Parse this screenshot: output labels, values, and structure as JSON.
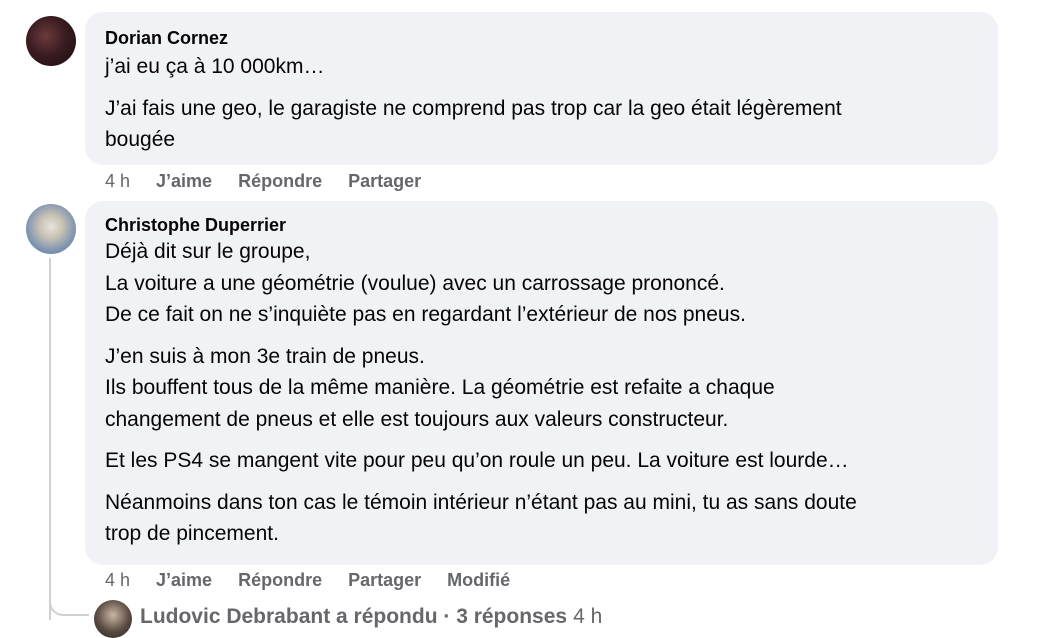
{
  "comments": [
    {
      "author": "Dorian Cornez",
      "paragraphs": [
        [
          "j’ai eu ça à 10 000km…"
        ],
        [
          "J’ai fais une geo, le garagiste ne comprend pas trop car la geo était légèrement",
          "bougée"
        ]
      ],
      "time": "4 h",
      "like": "J’aime",
      "reply": "Répondre",
      "share": "Partager"
    },
    {
      "author": "Christophe Duperrier",
      "paragraphs": [
        [
          "Déjà dit sur le groupe,",
          "La voiture a une géométrie (voulue) avec un carrossage prononcé.",
          "De ce fait on ne s’inquiète pas en regardant l’extérieur de nos pneus."
        ],
        [
          "J’en suis à mon 3e train de pneus.",
          "Ils bouffent tous de la même manière. La géométrie est refaite a chaque",
          "changement de pneus et elle est toujours aux valeurs constructeur."
        ],
        [
          "Et les PS4 se mangent vite pour peu qu’on roule un peu. La voiture est lourde…"
        ],
        [
          "Néanmoins dans ton cas le témoin intérieur n’étant pas au mini, tu as sans doute",
          "trop de pincement."
        ]
      ],
      "time": "4 h",
      "like": "J’aime",
      "reply": "Répondre",
      "share": "Partager",
      "edited": "Modifié"
    }
  ],
  "replies_summary": {
    "text": "Ludovic Debrabant a répondu · 3 réponses",
    "time": "4 h"
  }
}
